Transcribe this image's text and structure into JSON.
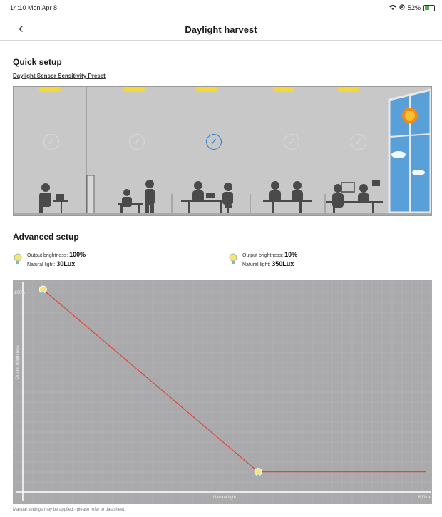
{
  "status_bar": {
    "time": "14:10  Mon Apr 8",
    "battery": "52%"
  },
  "nav": {
    "back_glyph": "‹",
    "title": "Daylight harvest"
  },
  "quick_setup": {
    "heading": "Quick setup",
    "preset_label": "Daylight Sensor Sensitivity Preset",
    "presets": [
      {
        "id": "p1",
        "selected": false
      },
      {
        "id": "p2",
        "selected": false
      },
      {
        "id": "p3",
        "selected": true
      },
      {
        "id": "p4",
        "selected": false
      },
      {
        "id": "p5",
        "selected": false
      }
    ]
  },
  "advanced_setup": {
    "heading": "Advanced setup",
    "point1": {
      "output_label": "Output brightness:",
      "output_value": "100%",
      "light_label": "Natural light:",
      "light_value": "30Lux"
    },
    "point2": {
      "output_label": "Output brightness:",
      "output_value": "10%",
      "light_label": "Natural light:",
      "light_value": "350Lux"
    }
  },
  "chart_data": {
    "type": "line",
    "xlabel": "Natural light",
    "ylabel": "Output brightness",
    "x_max_label": "600lux",
    "y_max_label": "100%",
    "xlim": [
      0,
      600
    ],
    "ylim": [
      0,
      100
    ],
    "series": [
      {
        "x": [
          30,
          350,
          600
        ],
        "y": [
          100,
          10,
          10
        ]
      }
    ],
    "grid": true
  },
  "footer": {
    "note": "Manual settings may be applied - please refer to datasheet"
  },
  "colors": {
    "accent": "#2f7fd3",
    "line": "#e0443a",
    "chart_bg": "#aaa9ab",
    "lamp": "#f3d83a"
  }
}
